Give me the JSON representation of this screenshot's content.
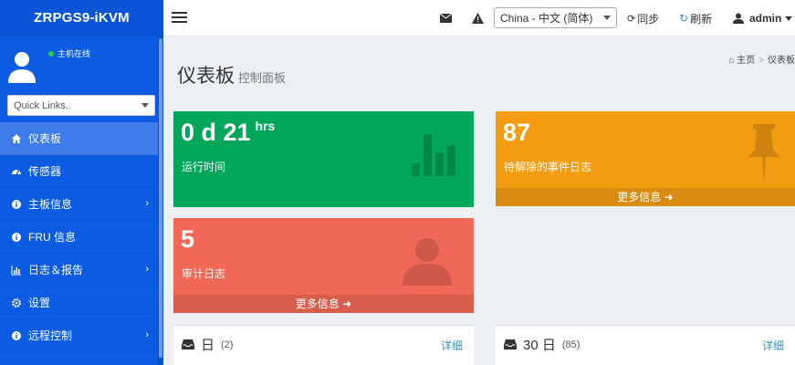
{
  "app": {
    "title": "ZRPGS9-iKVM"
  },
  "user_panel": {
    "status": "主机在线"
  },
  "quick_links": {
    "placeholder": "Quick Links.."
  },
  "sidebar": {
    "items": [
      {
        "label": "仪表板",
        "icon": "home-icon"
      },
      {
        "label": "传感器",
        "icon": "dashboard-icon"
      },
      {
        "label": "主板信息",
        "icon": "info-icon"
      },
      {
        "label": "FRU 信息",
        "icon": "info-icon"
      },
      {
        "label": "日志＆报告",
        "icon": "bar-chart-icon"
      },
      {
        "label": "设置",
        "icon": "gear-icon"
      },
      {
        "label": "远程控制",
        "icon": "info-icon"
      }
    ]
  },
  "topbar": {
    "language": "China - 中文 (简体)",
    "sync_label": "同步",
    "refresh_label": "刷新",
    "user_label": "admin"
  },
  "page": {
    "title": "仪表板",
    "subtitle": "控制面板"
  },
  "breadcrumb": {
    "home": "主页",
    "current": "仪表板"
  },
  "cards": {
    "uptime": {
      "value": "0 d 21",
      "unit": "hrs",
      "label": "运行时间"
    },
    "pending_events": {
      "value": "87",
      "label": "待解除的事件日志",
      "more": "更多信息"
    },
    "audit_log": {
      "value": "5",
      "label": "审计日志",
      "more": "更多信息"
    }
  },
  "panels": {
    "day": {
      "title": "日",
      "count": "(2)",
      "more": "详细"
    },
    "days30": {
      "title": "30 日",
      "count": "(85)",
      "more": "详细"
    }
  },
  "colors": {
    "sidebar": "#0b5be3",
    "green": "#00a65a",
    "orange": "#f39c12",
    "red": "#f26856"
  }
}
